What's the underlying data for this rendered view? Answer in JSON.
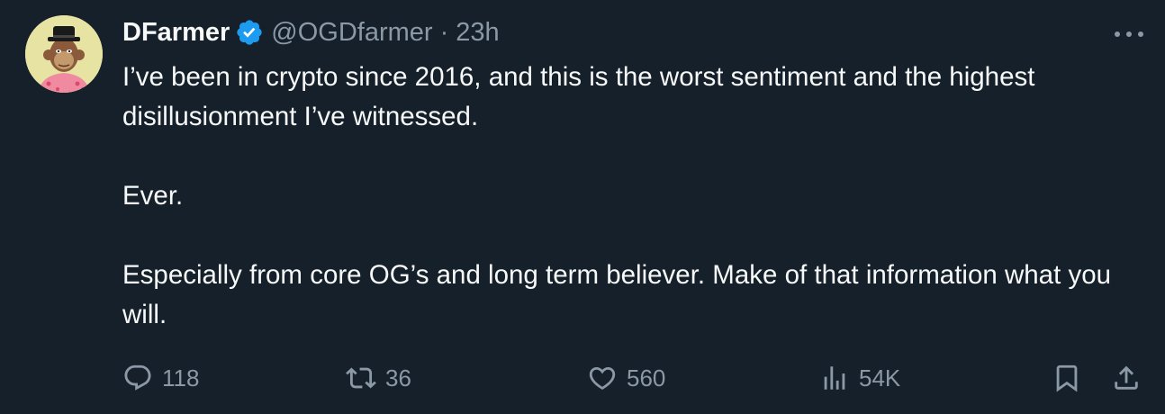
{
  "author": {
    "display_name": "DFarmer",
    "handle": "@OGDfarmer",
    "separator": "·",
    "time": "23h",
    "verified": true,
    "avatar_icon": "ape-avatar"
  },
  "tweet": {
    "lines": [
      "I’ve been in crypto since 2016, and this is the worst sentiment and the highest disillusionment I’ve witnessed.",
      "Ever.",
      "Especially from core OG’s and long term believer. Make of that information what you will."
    ]
  },
  "actions": {
    "replies": "118",
    "retweets": "36",
    "likes": "560",
    "views": "54K"
  },
  "icons": {
    "reply": "reply-icon",
    "retweet": "retweet-icon",
    "like": "heart-icon",
    "views": "views-icon",
    "bookmark": "bookmark-icon",
    "share": "share-icon",
    "more": "more-icon",
    "verified": "verified-badge-icon"
  },
  "colors": {
    "background": "#15202b",
    "text": "#f7f9f9",
    "secondary": "#8b98a5",
    "verified": "#1d9bf0"
  }
}
